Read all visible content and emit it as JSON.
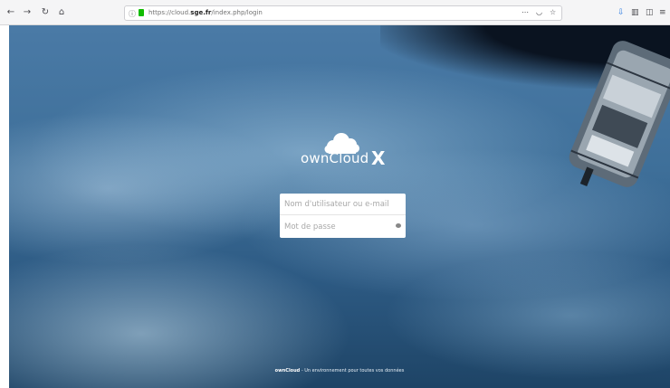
{
  "browser": {
    "url_prefix": "https://cloud.",
    "url_domain": "sge.fr",
    "url_path": "/index.php/login",
    "page_actions_icon": "⋯",
    "back_icon": "←",
    "forward_icon": "→",
    "reload_icon": "↻",
    "home_icon": "⌂"
  },
  "logo": {
    "text": "ownCloud",
    "suffix": "X"
  },
  "login": {
    "username_placeholder": "Nom d'utilisateur ou e-mail",
    "password_placeholder": "Mot de passe"
  },
  "footer": {
    "brand": "ownCloud",
    "tagline": " - Un environnement pour toutes vos données"
  }
}
